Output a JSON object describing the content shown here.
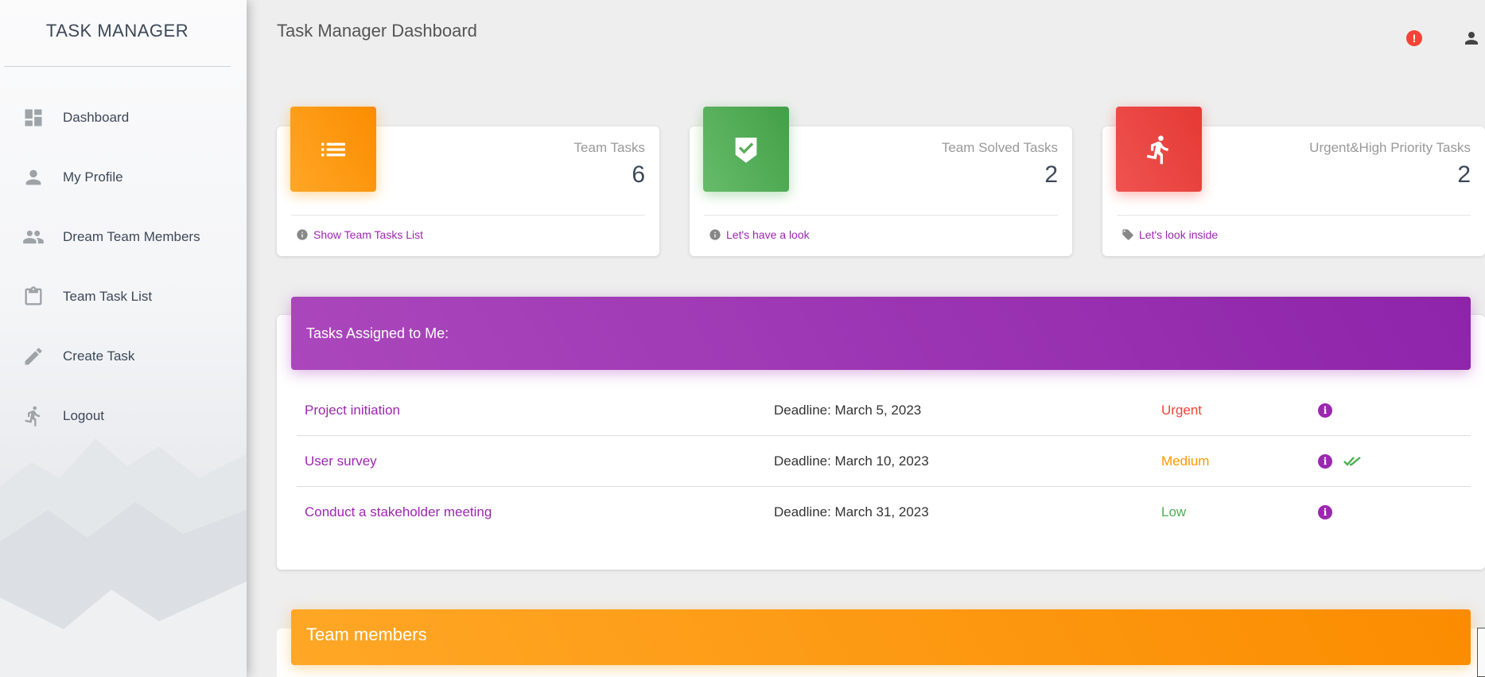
{
  "sidebar": {
    "brand": "TASK MANAGER",
    "items": [
      {
        "label": "Dashboard",
        "icon": "dashboard-icon"
      },
      {
        "label": "My Profile",
        "icon": "person-icon"
      },
      {
        "label": "Dream Team Members",
        "icon": "group-icon"
      },
      {
        "label": "Team Task List",
        "icon": "clipboard-icon"
      },
      {
        "label": "Create Task",
        "icon": "pencil-icon"
      },
      {
        "label": "Logout",
        "icon": "run-icon"
      }
    ]
  },
  "topbar": {
    "title": "Task Manager Dashboard",
    "alert_glyph": "!"
  },
  "cards": [
    {
      "category": "Team Tasks",
      "value": "6",
      "footer": "Show Team Tasks List",
      "color": "#fb8c00",
      "icon": "list-icon",
      "footer_icon": "info-icon"
    },
    {
      "category": "Team Solved Tasks",
      "value": "2",
      "footer": "Let's have a look",
      "color": "#43a047",
      "icon": "verified-shield-icon",
      "footer_icon": "info-icon"
    },
    {
      "category": "Urgent&High Priority Tasks",
      "value": "2",
      "footer": "Let's look inside",
      "color": "#e53935",
      "icon": "run-icon",
      "footer_icon": "tag-icon"
    }
  ],
  "tasks": {
    "title": "Tasks Assigned to Me:",
    "rows": [
      {
        "name": "Project initiation",
        "deadline": "Deadline: March 5, 2023",
        "priority": "Urgent",
        "priority_color": "#f44336",
        "info": "i",
        "done": false
      },
      {
        "name": "User survey",
        "deadline": "Deadline: March 10, 2023",
        "priority": "Medium",
        "priority_color": "#ff9800",
        "info": "i",
        "done": true
      },
      {
        "name": "Conduct a stakeholder meeting",
        "deadline": "Deadline: March 31, 2023",
        "priority": "Low",
        "priority_color": "#4caf50",
        "info": "i",
        "done": false
      }
    ]
  },
  "team": {
    "title": "Team members"
  },
  "colors": {
    "accent_purple": "#9c27b0",
    "orange": "#fb8c00",
    "green": "#43a047",
    "red": "#e53935"
  }
}
